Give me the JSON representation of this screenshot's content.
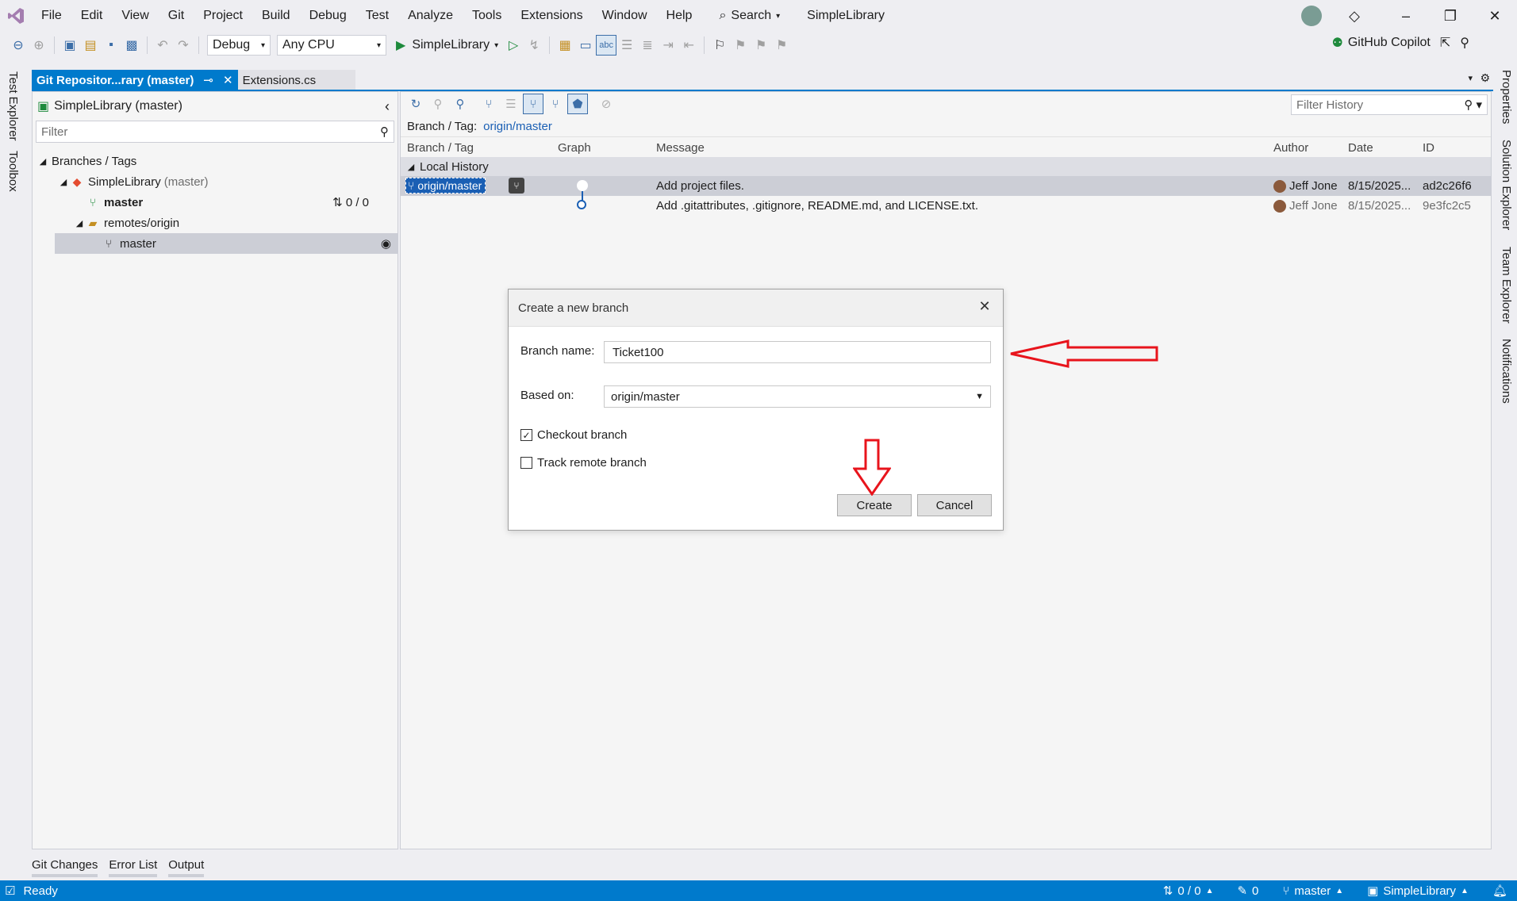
{
  "menu": {
    "items": [
      "File",
      "Edit",
      "View",
      "Git",
      "Project",
      "Build",
      "Debug",
      "Test",
      "Analyze",
      "Tools",
      "Extensions",
      "Window",
      "Help"
    ],
    "search_label": "Search",
    "solution_title": "SimpleLibrary"
  },
  "toolbar": {
    "config": "Debug",
    "platform": "Any CPU",
    "run_target": "SimpleLibrary",
    "copilot_label": "GitHub Copilot"
  },
  "side_tabs": {
    "left": [
      "Test Explorer",
      "Toolbox"
    ],
    "right": [
      "Properties",
      "Solution Explorer",
      "Team Explorer",
      "Notifications"
    ]
  },
  "tabs": {
    "active": "Git Repositor...rary (master)",
    "inactive": "Extensions.cs"
  },
  "left_pane": {
    "repo_title": "SimpleLibrary (master)",
    "filter_placeholder": "Filter",
    "section": "Branches / Tags",
    "repo_node": "SimpleLibrary",
    "repo_branch": "(master)",
    "local_branch": "master",
    "sync_count": "0 / 0",
    "remotes_node": "remotes/origin",
    "remote_branch": "master"
  },
  "right_pane": {
    "filter_history_placeholder": "Filter History",
    "branch_tag_label": "Branch / Tag:",
    "branch_tag_value": "origin/master",
    "columns": [
      "Branch / Tag",
      "Graph",
      "Message",
      "Author",
      "Date",
      "ID"
    ],
    "group": "Local History",
    "commits": [
      {
        "branch": "origin/master",
        "message": "Add project files.",
        "author": "Jeff Jone",
        "date": "8/15/2025...",
        "id": "ad2c26f6"
      },
      {
        "branch": "",
        "message": "Add .gitattributes, .gitignore, README.md, and LICENSE.txt.",
        "author": "Jeff Jone",
        "date": "8/15/2025...",
        "id": "9e3fc2c5"
      }
    ]
  },
  "dialog": {
    "title": "Create a new branch",
    "branch_name_label": "Branch name:",
    "branch_name_value": "Ticket100",
    "based_on_label": "Based on:",
    "based_on_value": "origin/master",
    "checkout_label": "Checkout branch",
    "checkout_checked": true,
    "track_label": "Track remote branch",
    "track_checked": false,
    "create_label": "Create",
    "cancel_label": "Cancel"
  },
  "bottom_tabs": [
    "Git Changes",
    "Error List",
    "Output"
  ],
  "status": {
    "ready": "Ready",
    "sync": "0 / 0",
    "pending": "0",
    "branch": "master",
    "repo": "SimpleLibrary"
  },
  "colors": {
    "accent": "#007acc",
    "annotation": "#e8141c",
    "link": "#1a5fb4"
  }
}
